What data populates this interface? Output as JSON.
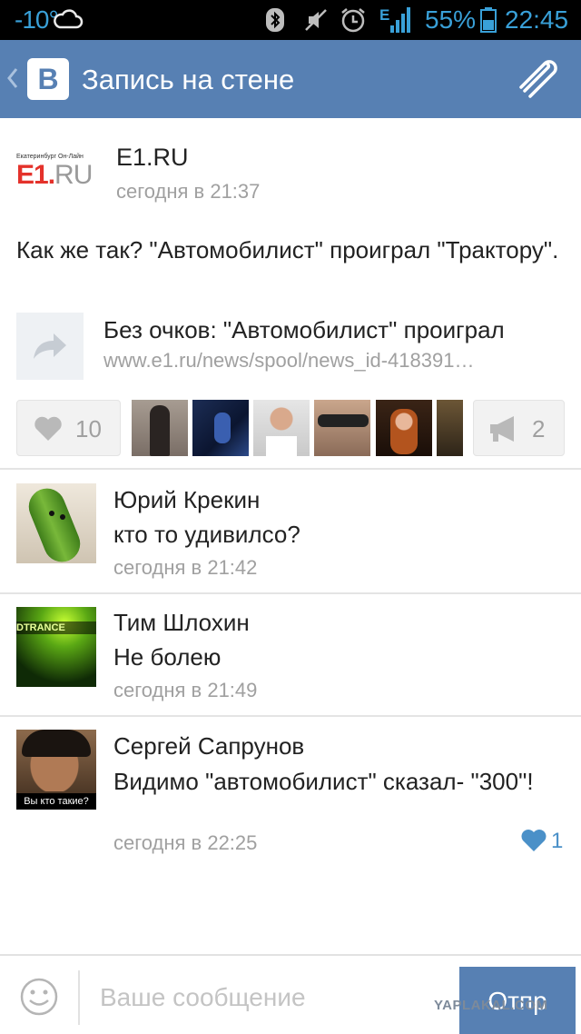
{
  "status_bar": {
    "temperature": "-10°",
    "battery_percent": "55%",
    "time": "22:45",
    "icons": [
      "cloud-icon",
      "bluetooth-icon",
      "mute-icon",
      "alarm-icon",
      "signal-icon",
      "battery-icon"
    ]
  },
  "header": {
    "logo_letter": "В",
    "title": "Запись на стене",
    "icons": [
      "back-chevron-icon",
      "attach-icon"
    ]
  },
  "post": {
    "logo_small": "Екатеринбург Он-Лайн",
    "logo_big": "E1.",
    "logo_big_suffix": "RU",
    "author": "E1.RU",
    "time": "сегодня в 21:37",
    "text": "Как же так? \"Автомобилист\" проиграл \"Трактору\".",
    "link_title": "Без очков: \"Автомобилист\" проиграл",
    "link_url": "www.e1.ru/news/spool/news_id-418391…",
    "likes": "10",
    "reposts": "2"
  },
  "comments": [
    {
      "author": "Юрий Крекин",
      "text": "кто то удивилсо?",
      "time": "сегодня в 21:42"
    },
    {
      "author": "Тим Шлохин",
      "text": "Не болею",
      "time": "сегодня в 21:49",
      "avatar_label": "DTRANCE"
    },
    {
      "author": "Сергей Сапрунов",
      "text": "Видимо \"автомобилист\" сказал- \"300\"!",
      "time": "сегодня в 22:25",
      "avatar_caption": "Вы кто такие?",
      "likes": "1"
    }
  ],
  "composer": {
    "placeholder": "Ваше сообщение",
    "send_label": "Отпр"
  },
  "watermark": "YAPLAKAL.COM",
  "colors": {
    "accent": "#5780b3",
    "status_text": "#39a0d8",
    "secondary_text": "#a0a0a0",
    "like_blue": "#4a90c8"
  }
}
